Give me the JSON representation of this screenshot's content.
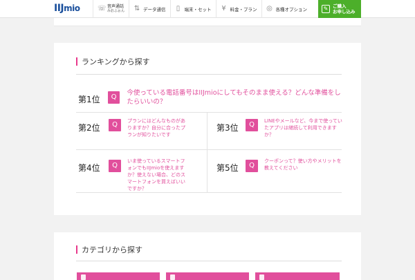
{
  "header": {
    "logo_primary": "IIJ",
    "logo_secondary": "mio",
    "nav": [
      {
        "icon": "phone-icon",
        "label": "音声通話",
        "sub": "みおふぉん"
      },
      {
        "icon": "data-icon",
        "label": "データ通信",
        "sub": ""
      },
      {
        "icon": "device-icon",
        "label": "端末・セット",
        "sub": ""
      },
      {
        "icon": "yen-icon",
        "label": "料金・プラン",
        "sub": ""
      },
      {
        "icon": "option-icon",
        "label": "各種オプション",
        "sub": ""
      }
    ],
    "cta_line1": "ご購入",
    "cta_line2": "お申し込み"
  },
  "ranking": {
    "title": "ランキングから探す",
    "q_label": "Q",
    "items": [
      {
        "rank": "第1位",
        "text": "今使っている電話番号はIIJmioにしてもそのまま使える？どんな準備をしたらいいの？"
      },
      {
        "rank": "第2位",
        "text": "プランにはどんなものがありますか？自分に合ったプランが知りたいです"
      },
      {
        "rank": "第3位",
        "text": "LINEやメールなど、今まで使っていたアプリは継続して利用できますか？"
      },
      {
        "rank": "第4位",
        "text": "いま使っているスマートフォンでもIIJmioを使えますか？使えない場合、どのスマートフォンを買えばいいですか？"
      },
      {
        "rank": "第5位",
        "text": "クーポンって？使い方やメリットを教えてください"
      }
    ]
  },
  "category": {
    "title": "カテゴリから探す"
  },
  "colors": {
    "accent_pink": "#e14f9c",
    "brand_blue": "#1a4f9c",
    "cta_green": "#4caf2a"
  }
}
